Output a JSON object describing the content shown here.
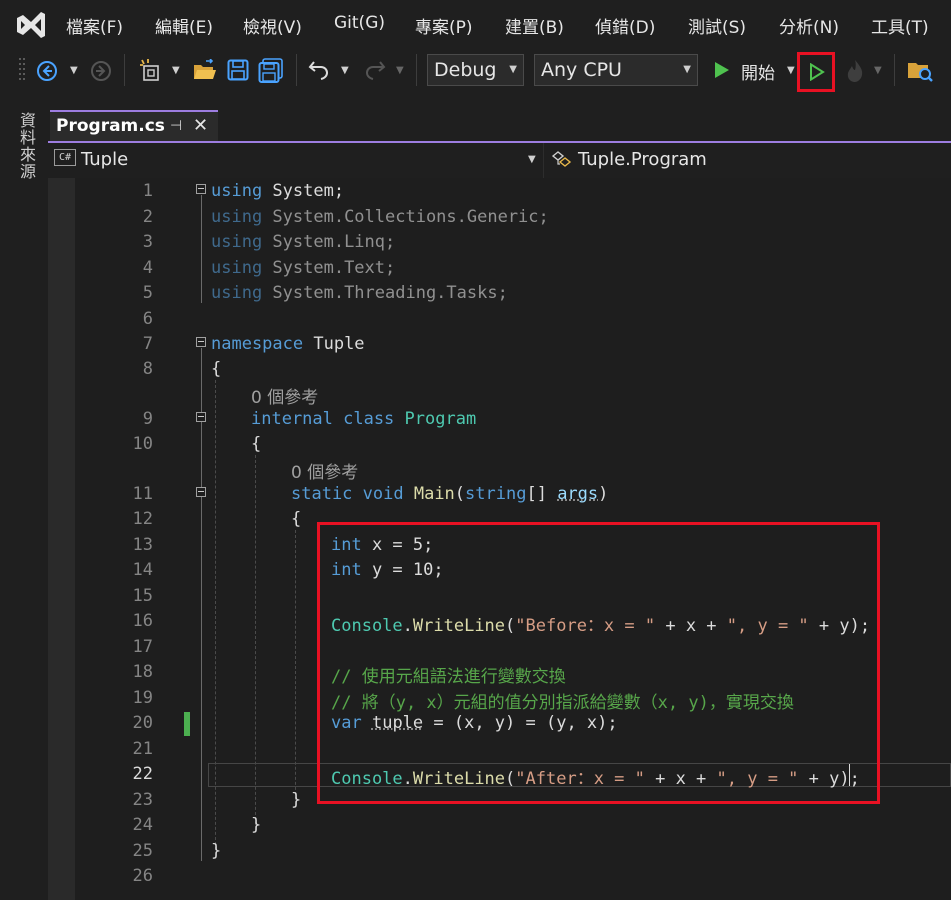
{
  "menu": [
    "檔案(F)",
    "編輯(E)",
    "檢視(V)",
    "Git(G)",
    "專案(P)",
    "建置(B)",
    "偵錯(D)",
    "測試(S)",
    "分析(N)",
    "工具(T)"
  ],
  "toolbar": {
    "config": "Debug",
    "platform": "Any CPU",
    "start_label": "開始"
  },
  "side_panel_label": "資料來源",
  "tab": {
    "file": "Program.cs",
    "pin": "⊣",
    "close": "✕"
  },
  "nav": {
    "scope": "Tuple",
    "member": "Tuple.Program"
  },
  "editor": {
    "line_numbers": [
      "1",
      "2",
      "3",
      "4",
      "5",
      "6",
      "7",
      "8",
      "9",
      "10",
      "11",
      "12",
      "13",
      "14",
      "15",
      "16",
      "17",
      "18",
      "19",
      "20",
      "21",
      "22",
      "23",
      "24",
      "25",
      "26"
    ],
    "current_line": "22",
    "refs_label_1": "0 個參考",
    "refs_label_2": "0 個參考"
  },
  "colors": {
    "accent": "#9d7de0",
    "highlight_box": "#e81123",
    "keyword": "#569cd6",
    "type": "#4ec9b0",
    "string": "#d69d85",
    "comment": "#57a64a"
  }
}
